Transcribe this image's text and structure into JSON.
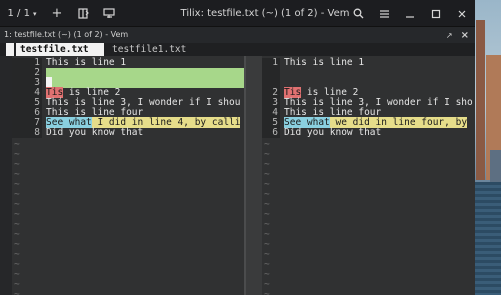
{
  "titlebar": {
    "counter": "1 / 1",
    "title": "Tilix: testfile.txt (~) (1 of 2) - Vem"
  },
  "session": {
    "title": "1: testfile.txt (~) (1 of 2) - Vem"
  },
  "vim": {
    "tabs": [
      "testfile.txt",
      "testfile1.txt"
    ],
    "left_lines": [
      {
        "num": "1",
        "text": "This is line 1"
      },
      {
        "num": "2",
        "text": ""
      },
      {
        "num": "3",
        "text": ""
      },
      {
        "num": "4",
        "text_red": "Tis",
        "text": " is line 2"
      },
      {
        "num": "5",
        "text": "This is line 3, I wonder if I shou"
      },
      {
        "num": "6",
        "text": "This is line four"
      },
      {
        "num": "7",
        "text_cyan": "See what",
        "text_yellow": " I did in line 4, by calli"
      },
      {
        "num": "8",
        "text": "Did you know that"
      }
    ],
    "right_lines": [
      {
        "num": "1",
        "text": "This is line 1"
      },
      {
        "num": "2",
        "text_red": "Tis",
        "text": " is line 2"
      },
      {
        "num": "3",
        "text": "This is line 3, I wonder if I sho"
      },
      {
        "num": "4",
        "text": "This is line four"
      },
      {
        "num": "5",
        "text_cyan": "See what",
        "text_yellow": " we did in line four, by"
      },
      {
        "num": "6",
        "text": "Did you know that"
      }
    ],
    "tilde": "~"
  }
}
